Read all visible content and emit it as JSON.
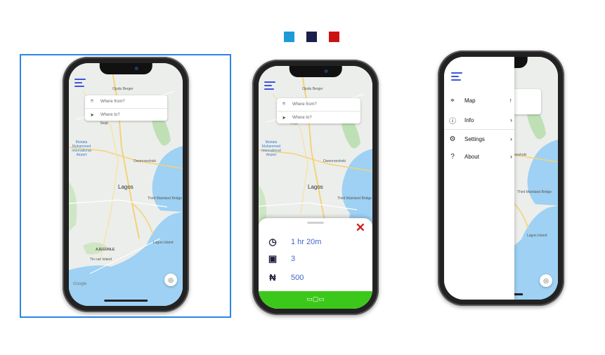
{
  "palette": {
    "swatches": [
      "#1d9bd6",
      "#1b1f4b",
      "#cc1111"
    ],
    "selected_frame": "#2b86e3",
    "brand_blue": "#3d55e0",
    "go_green": "#3cc81a",
    "close_red": "#cc1f1f"
  },
  "map": {
    "labels": {
      "ojodu": "Ojodu Berger",
      "ikeja": "Ikeja",
      "airport": "Murtala Muhammed International Airport",
      "owonronshoki": "Owonronshoki",
      "lagos": "Lagos",
      "ajegunle": "AJEGUNLE",
      "lagos_island": "Lagos Island",
      "tincan": "Tin can Island",
      "third_mainland": "Third Mainland Bridge"
    },
    "google": "Google"
  },
  "search": {
    "from_placeholder": "Where from?",
    "to_placeholder": "Where to?"
  },
  "trip": {
    "duration": "1 hr 20m",
    "buses": "3",
    "fare": "500",
    "currency_icon": "₦"
  },
  "drawer": {
    "items": [
      {
        "label": "Map",
        "icon": "map-pin-icon"
      },
      {
        "label": "Info",
        "icon": "info-icon"
      },
      {
        "label": "Settings",
        "icon": "gear-icon"
      },
      {
        "label": "About",
        "icon": "question-icon"
      }
    ],
    "partial_labels": {
      "onshoki": "onshoki",
      "bridge": "Third Mainland Bridge",
      "island": "Lagos Island"
    }
  }
}
